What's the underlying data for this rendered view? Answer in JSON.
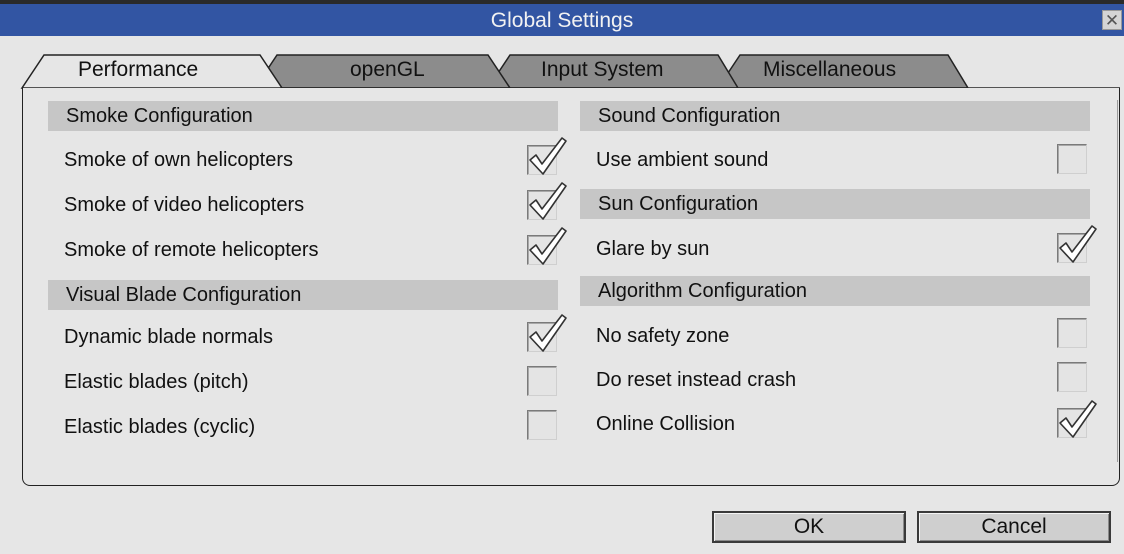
{
  "window": {
    "title": "Global Settings",
    "close_glyph": "✕"
  },
  "tabs": [
    {
      "label": "Performance",
      "active": true
    },
    {
      "label": "openGL",
      "active": false
    },
    {
      "label": "Input System",
      "active": false
    },
    {
      "label": "Miscellaneous",
      "active": false
    }
  ],
  "left": {
    "smoke_header": "Smoke Configuration",
    "smoke_own": {
      "label": "Smoke of own helicopters",
      "checked": true
    },
    "smoke_video": {
      "label": "Smoke of video helicopters",
      "checked": true
    },
    "smoke_remote": {
      "label": "Smoke of remote helicopters",
      "checked": true
    },
    "blade_header": "Visual Blade Configuration",
    "dynamic_normals": {
      "label": "Dynamic blade normals",
      "checked": true
    },
    "elastic_pitch": {
      "label": "Elastic blades (pitch)",
      "checked": false
    },
    "elastic_cyclic": {
      "label": "Elastic blades (cyclic)",
      "checked": false
    }
  },
  "right": {
    "sound_header": "Sound Configuration",
    "ambient_sound": {
      "label": "Use ambient sound",
      "checked": false
    },
    "sun_header": "Sun Configuration",
    "glare": {
      "label": "Glare by sun",
      "checked": true
    },
    "algo_header": "Algorithm Configuration",
    "no_safety": {
      "label": "No safety zone",
      "checked": false
    },
    "reset_crash": {
      "label": "Do reset instead crash",
      "checked": false
    },
    "online_collision": {
      "label": "Online Collision",
      "checked": true
    }
  },
  "buttons": {
    "ok": "OK",
    "cancel": "Cancel"
  },
  "colors": {
    "titlebar": "#3255a3",
    "active_tab": "#e6e6e6",
    "inactive_tab": "#8c8c8c",
    "section_header": "#c6c6c6",
    "background": "#e6e6e6"
  }
}
